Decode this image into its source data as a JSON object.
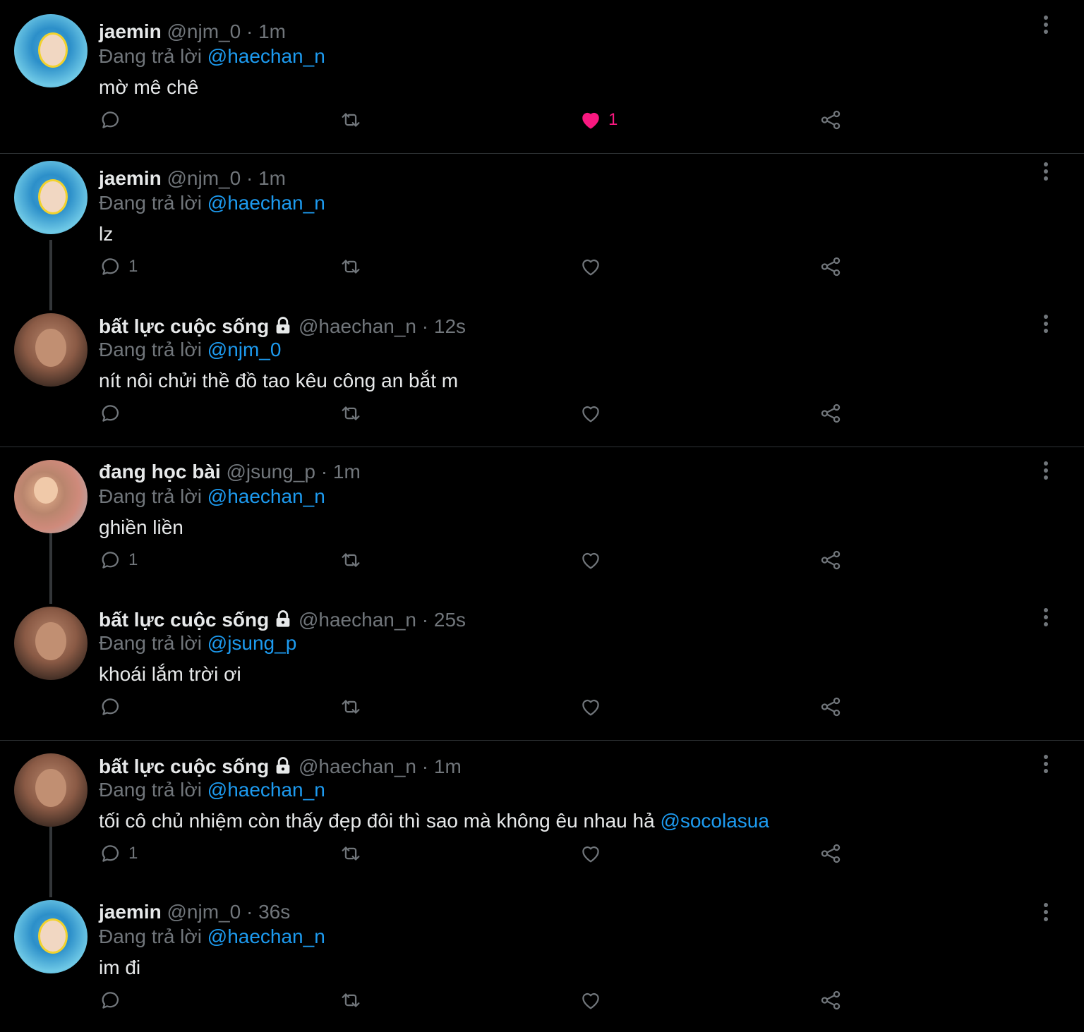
{
  "reply_prefix": "Đang trả lời",
  "tweets": [
    {
      "name": "jaemin",
      "handle": "@njm_0",
      "separator": "·",
      "time": "1m",
      "reply_to": "@haechan_n",
      "text": "mờ mê chê",
      "mention": "",
      "reply_count": "",
      "like_count": "1",
      "liked": true,
      "avatar": "jaemin"
    },
    {
      "name": "jaemin",
      "handle": "@njm_0",
      "separator": "·",
      "time": "1m",
      "reply_to": "@haechan_n",
      "text": "lz",
      "mention": "",
      "reply_count": "1",
      "like_count": "",
      "liked": false,
      "avatar": "jaemin"
    },
    {
      "name": "bất lực cuộc sống",
      "handle": "@haechan_n",
      "separator": "·",
      "time": "12s",
      "reply_to": "@njm_0",
      "text": "nít nôi chửi thề đồ tao kêu công an bắt m",
      "mention": "",
      "reply_count": "",
      "like_count": "",
      "liked": false,
      "avatar": "haechan",
      "locked": true
    },
    {
      "name": "đang học bài",
      "handle": "@jsung_p",
      "separator": "·",
      "time": "1m",
      "reply_to": "@haechan_n",
      "text": "ghiền liền",
      "mention": "",
      "reply_count": "1",
      "like_count": "",
      "liked": false,
      "avatar": "jsung"
    },
    {
      "name": "bất lực cuộc sống",
      "handle": "@haechan_n",
      "separator": "·",
      "time": "25s",
      "reply_to": "@jsung_p",
      "text": "khoái lắm trời ơi",
      "mention": "",
      "reply_count": "",
      "like_count": "",
      "liked": false,
      "avatar": "haechan",
      "locked": true
    },
    {
      "name": "bất lực cuộc sống",
      "handle": "@haechan_n",
      "separator": "·",
      "time": "1m",
      "reply_to": "@haechan_n",
      "text": "tối cô chủ nhiệm còn thấy đẹp đôi thì sao mà không êu nhau hả ",
      "mention": "@socolasua",
      "reply_count": "1",
      "like_count": "",
      "liked": false,
      "avatar": "haechan",
      "locked": true
    },
    {
      "name": "jaemin",
      "handle": "@njm_0",
      "separator": "·",
      "time": "36s",
      "reply_to": "@haechan_n",
      "text": "im đi",
      "mention": "",
      "reply_count": "",
      "like_count": "",
      "liked": false,
      "avatar": "jaemin"
    }
  ],
  "colors": {
    "background": "#000000",
    "accent": "#1d9bf0",
    "like": "#f91880",
    "muted": "#71767b"
  }
}
